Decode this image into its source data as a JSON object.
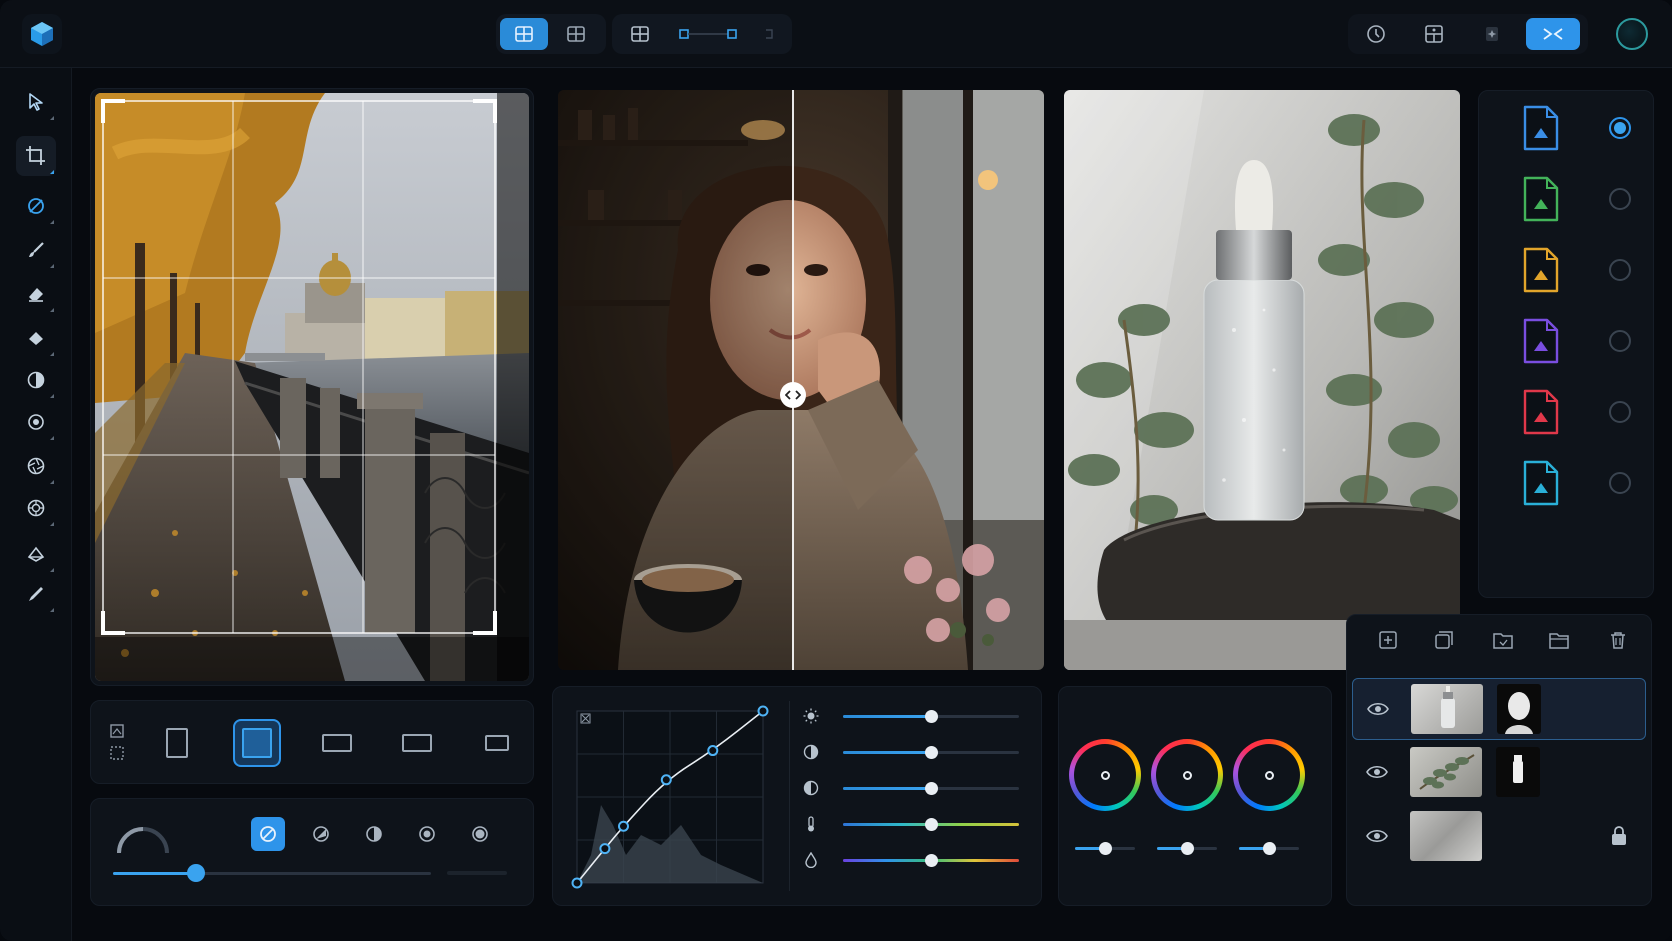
{
  "colors": {
    "accent": "#2e94ea",
    "background": "#070a0f",
    "panel": "#0e131a"
  },
  "topbar": {
    "logo_icon": "cube-logo-icon",
    "view_buttons": [
      {
        "name": "single-view-icon",
        "active": true
      },
      {
        "name": "grid-view-icon",
        "active": false
      }
    ],
    "layout_buttons": [
      {
        "name": "layout-grid-icon"
      },
      {
        "name": "compare-slider-icon"
      }
    ],
    "right_buttons": [
      {
        "name": "history-icon"
      },
      {
        "name": "layout-settings-icon"
      },
      {
        "name": "magic-icon"
      },
      {
        "name": "export-icon"
      }
    ]
  },
  "tools": [
    {
      "name": "select-tool-icon"
    },
    {
      "name": "crop-tool-icon"
    },
    {
      "name": "mask-tool-icon"
    },
    {
      "name": "brush-tool-icon"
    },
    {
      "name": "eraser-tool-icon"
    },
    {
      "name": "fill-tool-icon"
    },
    {
      "name": "contrast-tool-icon"
    },
    {
      "name": "dodge-tool-icon"
    },
    {
      "name": "aperture-tool-icon"
    },
    {
      "name": "lens-tool-icon"
    },
    {
      "name": "shape-tool-icon"
    },
    {
      "name": "pen-tool-icon"
    }
  ],
  "crop_ratios": [
    {
      "name": "ratio-portrait-icon",
      "active": false
    },
    {
      "name": "ratio-square-icon",
      "active": true
    },
    {
      "name": "ratio-landscape-icon",
      "active": false
    },
    {
      "name": "ratio-wide-icon",
      "active": false
    },
    {
      "name": "ratio-panorama-icon",
      "active": false
    }
  ],
  "brush": {
    "size_fraction": 0.26,
    "modes": [
      "mode-none-icon",
      "mode-soft-icon",
      "mode-half-icon",
      "mode-radial-icon",
      "mode-ring-icon"
    ]
  },
  "curves": {
    "points": [
      [
        0,
        0
      ],
      [
        0.15,
        0.2
      ],
      [
        0.25,
        0.33
      ],
      [
        0.48,
        0.6
      ],
      [
        0.73,
        0.77
      ],
      [
        1,
        1
      ]
    ]
  },
  "adjustments": [
    {
      "name": "brightness-icon",
      "value": 0.5
    },
    {
      "name": "contrast-icon",
      "value": 0.5
    },
    {
      "name": "exposure-icon",
      "value": 0.5
    },
    {
      "name": "temperature-icon",
      "value": 0.5
    },
    {
      "name": "tint-icon",
      "value": 0.5
    }
  ],
  "color_wheels": [
    {
      "name": "shadows-wheel",
      "value": 0.5
    },
    {
      "name": "midtones-wheel",
      "value": 0.5
    },
    {
      "name": "highlights-wheel",
      "value": 0.5
    }
  ],
  "presets": [
    {
      "name": "preset-blue",
      "color": "#3a8ee6",
      "selected": true
    },
    {
      "name": "preset-green",
      "color": "#43b35a",
      "selected": false
    },
    {
      "name": "preset-gold",
      "color": "#e2a52b",
      "selected": false
    },
    {
      "name": "preset-purple",
      "color": "#7a4ee0",
      "selected": false
    },
    {
      "name": "preset-red",
      "color": "#e0384a",
      "selected": false
    },
    {
      "name": "preset-cyan",
      "color": "#2ab0d8",
      "selected": false
    }
  ],
  "layers": [
    {
      "name": "layer-bottle",
      "visible": true,
      "selected": true,
      "has_mask": true,
      "locked": false
    },
    {
      "name": "layer-leaves",
      "visible": true,
      "selected": false,
      "has_mask": true,
      "locked": false
    },
    {
      "name": "layer-background",
      "visible": true,
      "selected": false,
      "has_mask": false,
      "locked": true
    }
  ]
}
